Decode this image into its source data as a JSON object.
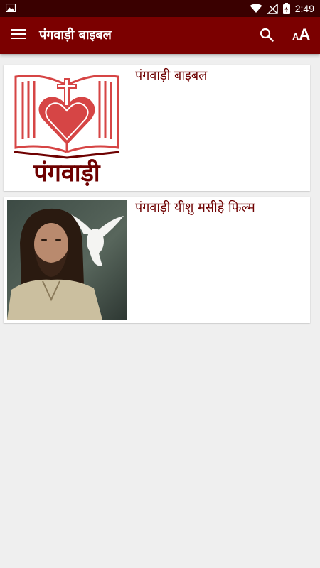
{
  "status_bar": {
    "time": "2:49",
    "icons": [
      "gallery-icon",
      "wifi-icon",
      "no-signal-icon",
      "battery-charging-icon"
    ]
  },
  "app_bar": {
    "title": "पंगवाड़ी बाइबल",
    "menu_icon": "hamburger-menu-icon",
    "search_icon": "search-icon",
    "font_size_icon": "font-size-icon",
    "font_size_small": "A",
    "font_size_big": "A"
  },
  "cards": [
    {
      "title": "पंगवाड़ी बाइबल",
      "thumbnail": "bible-logo-image",
      "logo_text": "पंगवाड़ी"
    },
    {
      "title": "पंगवाड़ी यीशु मसीहे फिल्म",
      "thumbnail": "jesus-with-dove-photo"
    }
  ],
  "colors": {
    "primary": "#7b0000",
    "primary_dark": "#3a0000",
    "title_text": "#6e0000",
    "logo_red": "#d64545",
    "background": "#efefef",
    "card": "#ffffff"
  }
}
